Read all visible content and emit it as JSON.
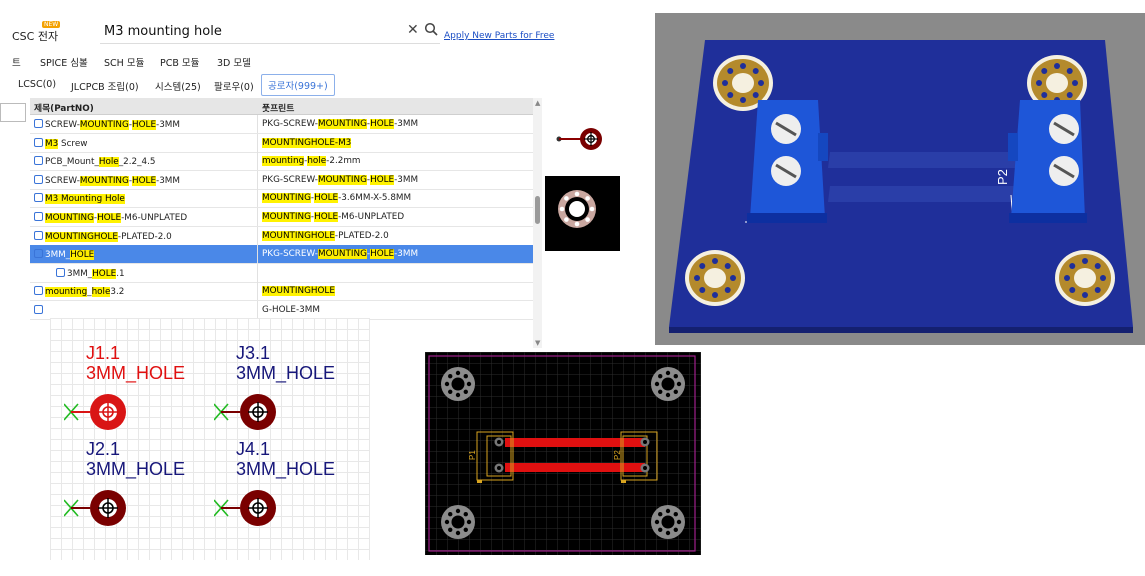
{
  "search": {
    "source_label": "CSC 전자",
    "new_badge": "NEW",
    "query": "M3 mounting hole",
    "clear_icon": "close-icon",
    "search_icon": "search-icon",
    "apply_link": "Apply New Parts for Free"
  },
  "categories": {
    "items": [
      "트",
      "SPICE 심볼",
      "SCH 모듈",
      "PCB 모듈",
      "3D 모델"
    ]
  },
  "source_tabs": {
    "items": [
      "LCSC(0)",
      "JLCPCB 조립(0)",
      "시스템(25)",
      "팔로우(0)",
      "공로자(999+)"
    ],
    "active_index": 4
  },
  "table": {
    "headers": [
      "제목(PartNO)",
      "풋프린트"
    ],
    "rows": [
      {
        "name": [
          [
            "SCREW-",
            0
          ],
          [
            "MOUNTING",
            1
          ],
          [
            "-",
            0
          ],
          [
            "HOLE",
            1
          ],
          [
            "-3MM",
            0
          ]
        ],
        "fp": [
          [
            "PKG-SCREW-",
            0
          ],
          [
            "MOUNTING",
            1
          ],
          [
            "-",
            0
          ],
          [
            "HOLE",
            1
          ],
          [
            "-3MM",
            0
          ]
        ]
      },
      {
        "name": [
          [
            "M3",
            1
          ],
          [
            " Screw",
            0
          ]
        ],
        "fp": [
          [
            "MOUNTINGHOLE-M3",
            1
          ]
        ]
      },
      {
        "name": [
          [
            "PCB_Mount_",
            0
          ],
          [
            "Hole",
            1
          ],
          [
            "_2.2_4.5",
            0
          ]
        ],
        "fp": [
          [
            "mounting",
            1
          ],
          [
            "-",
            0
          ],
          [
            "hole",
            1
          ],
          [
            "-2.2mm",
            0
          ]
        ]
      },
      {
        "name": [
          [
            "SCREW-",
            0
          ],
          [
            "MOUNTING",
            1
          ],
          [
            "-",
            0
          ],
          [
            "HOLE",
            1
          ],
          [
            "-3MM",
            0
          ]
        ],
        "fp": [
          [
            "PKG-SCREW-",
            0
          ],
          [
            "MOUNTING",
            1
          ],
          [
            "-",
            0
          ],
          [
            "HOLE",
            1
          ],
          [
            "-3MM",
            0
          ]
        ]
      },
      {
        "name": [
          [
            "M3 Mounting Hole",
            1
          ]
        ],
        "fp": [
          [
            "MOUNTING",
            1
          ],
          [
            "-",
            0
          ],
          [
            "HOLE",
            1
          ],
          [
            "-3.6MM-X-5.8MM",
            0
          ]
        ]
      },
      {
        "name": [
          [
            "MOUNTING",
            1
          ],
          [
            "-",
            0
          ],
          [
            "HOLE",
            1
          ],
          [
            "-M6-UNPLATED",
            0
          ]
        ],
        "fp": [
          [
            "MOUNTING",
            1
          ],
          [
            "-",
            0
          ],
          [
            "HOLE",
            1
          ],
          [
            "-M6-UNPLATED",
            0
          ]
        ]
      },
      {
        "name": [
          [
            "MOUNTINGHOLE",
            1
          ],
          [
            "-PLATED-2.0",
            0
          ]
        ],
        "fp": [
          [
            "MOUNTINGHOLE",
            1
          ],
          [
            "-PLATED-2.0",
            0
          ]
        ]
      },
      {
        "name": [
          [
            "3MM_",
            0
          ],
          [
            "HOLE",
            1
          ]
        ],
        "fp": [
          [
            "PKG-SCREW-",
            0
          ],
          [
            "MOUNTING",
            1
          ],
          [
            "-",
            0
          ],
          [
            "HOLE",
            1
          ],
          [
            "-3MM",
            0
          ]
        ],
        "selected": true
      },
      {
        "name": [
          [
            "3MM_",
            0
          ],
          [
            "HOLE",
            1
          ],
          [
            ".1",
            0
          ]
        ],
        "fp": [],
        "indent": true
      },
      {
        "name": [
          [
            "mounting",
            1
          ],
          [
            "_",
            0
          ],
          [
            "hole",
            1
          ],
          [
            "3.2",
            0
          ]
        ],
        "fp": [
          [
            "MOUNTINGHOLE",
            1
          ]
        ]
      },
      {
        "name": [
          [
            "",
            0
          ]
        ],
        "fp": [
          [
            "G-HOLE-3MM",
            0
          ]
        ]
      }
    ]
  },
  "schematic": {
    "parts": [
      {
        "ref": "J1.1",
        "value": "3MM_HOLE",
        "selected": true
      },
      {
        "ref": "J3.1",
        "value": "3MM_HOLE"
      },
      {
        "ref": "J2.1",
        "value": "3MM_HOLE"
      },
      {
        "ref": "J4.1",
        "value": "3MM_HOLE"
      }
    ]
  },
  "pcb": {
    "labels": [
      "P1",
      "P2"
    ]
  },
  "view3d": {
    "labels": [
      "P2"
    ]
  },
  "colors": {
    "highlight": "#fff200",
    "selected_row": "#4a88e8",
    "board_blue": "#1f2f9a",
    "trace_red": "#e01010",
    "schematic_text": "#17177a"
  }
}
